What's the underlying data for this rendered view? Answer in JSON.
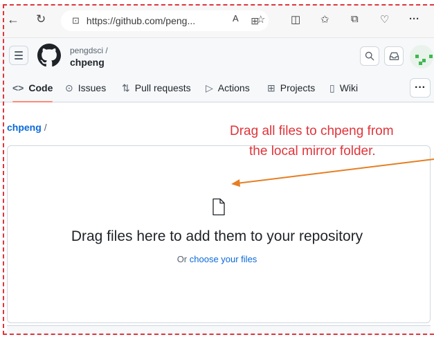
{
  "browser": {
    "url": "https://github.com/peng...",
    "back_icon": "arrow-left-icon",
    "reload_icon": "reload-icon"
  },
  "header": {
    "owner": "pengdsci /",
    "repo": "chpeng"
  },
  "tabs": [
    {
      "label": "Code",
      "icon": "code-icon",
      "active": true
    },
    {
      "label": "Issues",
      "icon": "issue-icon"
    },
    {
      "label": "Pull requests",
      "icon": "pull-request-icon"
    },
    {
      "label": "Actions",
      "icon": "play-icon"
    },
    {
      "label": "Projects",
      "icon": "table-icon"
    },
    {
      "label": "Wiki",
      "icon": "book-icon"
    }
  ],
  "breadcrumb": {
    "repo": "chpeng",
    "separator": "/"
  },
  "dropzone": {
    "title": "Drag files here to add them to your repository",
    "sub_prefix": "Or ",
    "sub_link": "choose your files"
  },
  "annotation": {
    "line1": "Drag all files to chpeng from",
    "line2": "the local mirror folder.",
    "color": "#e0343a",
    "arrow_color": "#e67e22"
  }
}
